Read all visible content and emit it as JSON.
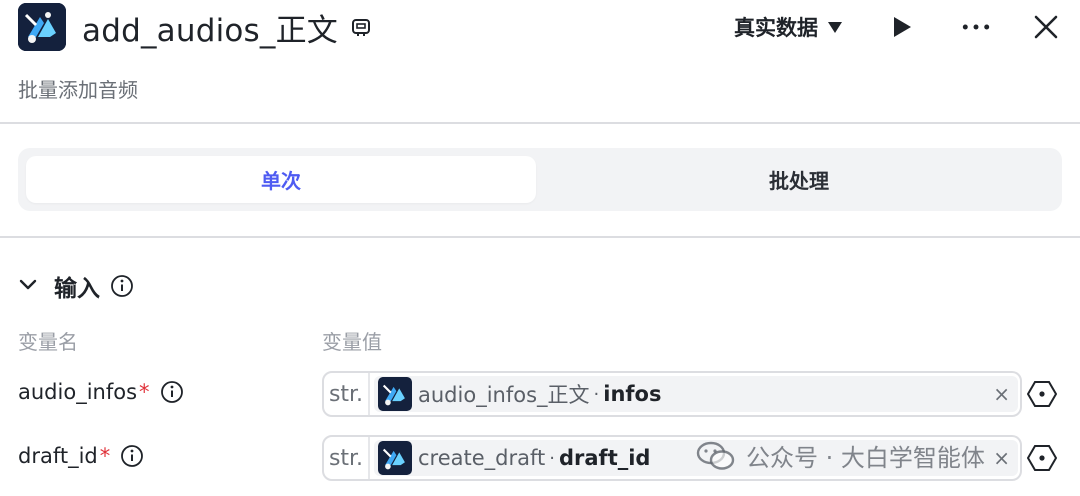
{
  "header": {
    "title": "add_audios_正文",
    "data_select": "真实数据",
    "subtitle": "批量添加音频"
  },
  "mode_tabs": [
    {
      "label": "单次",
      "active": true
    },
    {
      "label": "批处理",
      "active": false
    }
  ],
  "input_section": {
    "title": "输入",
    "col_name": "变量名",
    "col_value": "变量值",
    "rows": [
      {
        "name": "audio_infos",
        "required": "*",
        "type": "str.",
        "ref_node": "audio_infos_正文",
        "ref_dot": "·",
        "ref_field": "infos",
        "clear": "×"
      },
      {
        "name": "draft_id",
        "required": "*",
        "type": "str.",
        "ref_node": "create_draft",
        "ref_dot": "·",
        "ref_field": "draft_id",
        "clear": "×"
      }
    ]
  },
  "watermark": {
    "text": "公众号 · 大白学智能体"
  },
  "colors": {
    "accent": "#4e5bf2",
    "required": "#e0323a",
    "muted": "#9a9ea6"
  },
  "icons": {
    "app": "app-logo-icon",
    "edit": "edit-icon",
    "run": "play-icon",
    "more": "more-icon",
    "close": "close-icon",
    "collapse": "chevron-down-icon",
    "info": "info-icon",
    "variable": "variable-hex-icon"
  }
}
